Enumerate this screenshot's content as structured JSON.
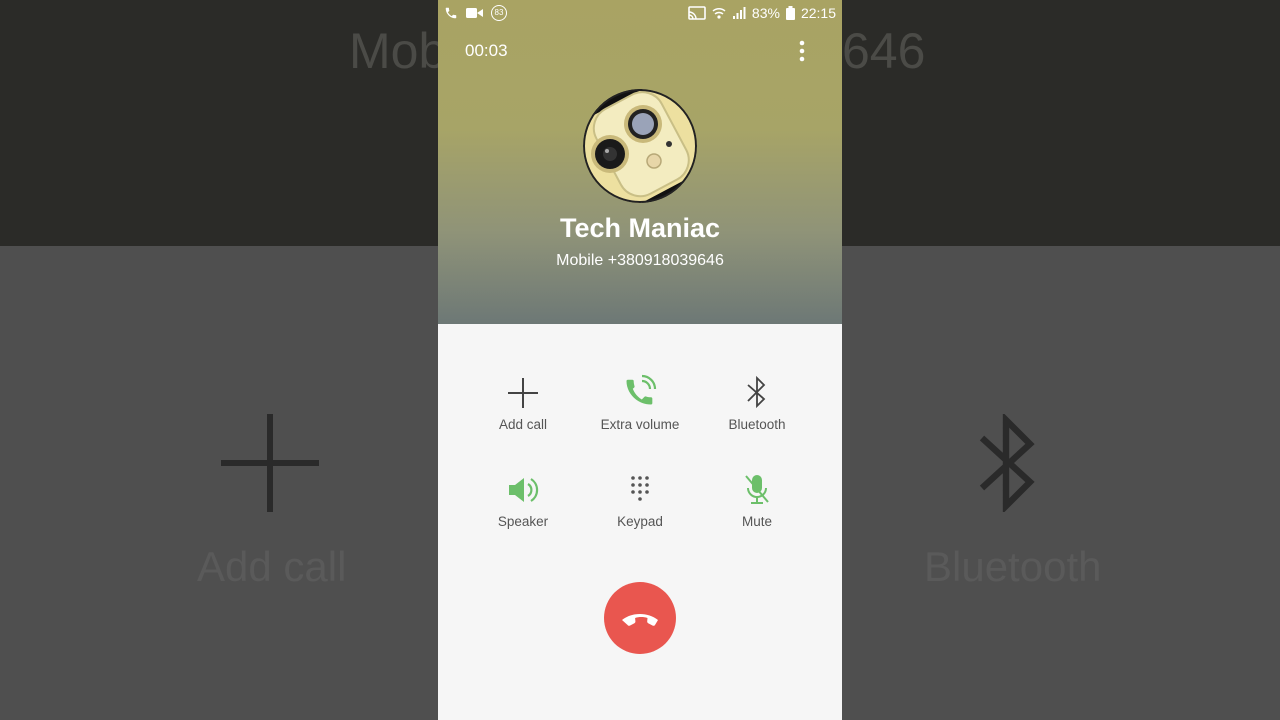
{
  "call": {
    "timer": "00:03",
    "contact_name": "Tech Maniac",
    "number_line": "Mobile  +380918039646"
  },
  "status_bar": {
    "notification_count": "83",
    "battery": "83%",
    "time": "22:15"
  },
  "actions": {
    "add_call": "Add call",
    "extra_volume": "Extra volume",
    "bluetooth": "Bluetooth",
    "speaker": "Speaker",
    "keypad": "Keypad",
    "mute": "Mute"
  },
  "background": {
    "top_left_text": "Mob",
    "top_right_text": "646",
    "left_text": "Add call",
    "right_text": "Bluetooth"
  },
  "colors": {
    "accent_green": "#6cbf6a",
    "end_call_red": "#e9564f"
  }
}
